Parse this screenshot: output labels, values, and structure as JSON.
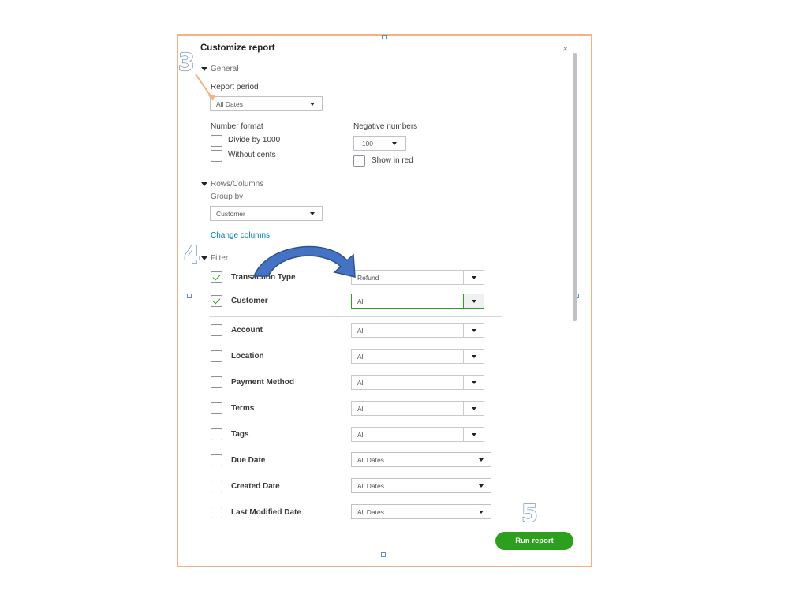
{
  "dialog": {
    "title": "Customize report",
    "close": "×"
  },
  "general": {
    "section_label": "General",
    "report_period_label": "Report period",
    "report_period_value": "All Dates",
    "number_format_label": "Number format",
    "divide_by_1000": "Divide by 1000",
    "without_cents": "Without cents",
    "negative_numbers_label": "Negative numbers",
    "negative_numbers_value": "-100",
    "show_in_red": "Show in red"
  },
  "rows_columns": {
    "section_label": "Rows/Columns",
    "group_by_label": "Group by",
    "group_by_value": "Customer",
    "change_columns": "Change columns"
  },
  "filter": {
    "section_label": "Filter",
    "items": [
      {
        "label": "Transaction Type",
        "value": "Refund",
        "checked": true
      },
      {
        "label": "Customer",
        "value": "All",
        "checked": true
      },
      {
        "label": "Account",
        "value": "All",
        "checked": false
      },
      {
        "label": "Location",
        "value": "All",
        "checked": false
      },
      {
        "label": "Payment Method",
        "value": "All",
        "checked": false
      },
      {
        "label": "Terms",
        "value": "All",
        "checked": false
      },
      {
        "label": "Tags",
        "value": "All",
        "checked": false
      },
      {
        "label": "Due Date",
        "value": "All Dates",
        "checked": false
      },
      {
        "label": "Created Date",
        "value": "All Dates",
        "checked": false
      },
      {
        "label": "Last Modified Date",
        "value": "All Dates",
        "checked": false
      }
    ]
  },
  "footer": {
    "run_report": "Run report"
  },
  "annotations": {
    "step3": "3",
    "step4": "4",
    "step5": "5"
  },
  "colors": {
    "accent_green": "#2ca01c",
    "link_blue": "#0077c5",
    "frame_orange": "#f4b183",
    "arrow_blue": "#4472c4"
  }
}
